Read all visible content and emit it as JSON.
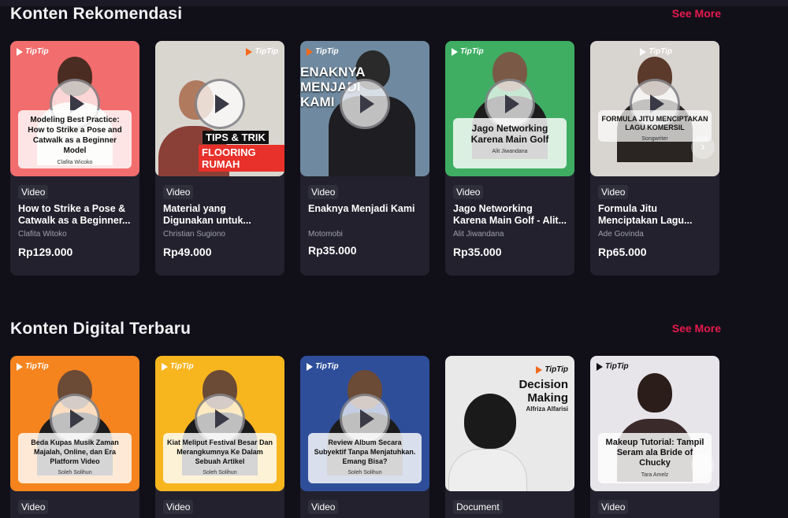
{
  "sections": [
    {
      "title": "Konten Rekomendasi",
      "see_more": "See More",
      "cards": [
        {
          "badge": "Video",
          "title": "How to Strike a Pose & Catwalk as a Beginner...",
          "creator": "Clafita Witoko",
          "price": "Rp129.000",
          "logo": "TipTip",
          "overlay_title": "Modeling Best Practice: How to Strike a Pose and Catwalk as a Beginner Model",
          "overlay_author": "Clafita Wicoko",
          "bg": "#f26d6d"
        },
        {
          "badge": "Video",
          "title": "Material yang Digunakan untuk...",
          "creator": "Christian Sugiono",
          "price": "Rp49.000",
          "logo": "TipTip",
          "thumb_tips": "TIPS & TRIK",
          "thumb_flooring": "FLOORING RUMAH",
          "bg": "#d9d6d0"
        },
        {
          "badge": "Video",
          "title": "Enaknya Menjadi Kami",
          "creator": "Motomobi",
          "price": "Rp35.000",
          "logo": "TipTip",
          "thumb_text": "ENAKNYA MENJADI KAMI",
          "bg": "#6f8aa0"
        },
        {
          "badge": "Video",
          "title": "Jago Networking Karena Main Golf - Alit...",
          "creator": "Alit Jiwandana",
          "price": "Rp35.000",
          "logo": "TipTip",
          "overlay_title": "Jago Networking Karena Main Golf",
          "overlay_author": "Alit Jiwandana",
          "bg": "#3fae62"
        },
        {
          "badge": "Video",
          "title": "Formula Jitu Menciptakan Lagu...",
          "creator": "Ade Govinda",
          "price": "Rp65.000",
          "logo": "TipTip",
          "overlay_title": "FORMULA JITU MENCIPTAKAN LAGU KOMERSIL",
          "overlay_author": "Songwriter",
          "bg": "#d8d4d0"
        }
      ]
    },
    {
      "title": "Konten Digital Terbaru",
      "see_more": "See More",
      "cards": [
        {
          "badge": "Video",
          "logo": "TipTip",
          "overlay_title": "Beda Kupas Musik Zaman Majalah, Online, dan Era Platform Video",
          "overlay_author": "Soleh Solihun",
          "bg": "#f5841f"
        },
        {
          "badge": "Video",
          "logo": "TipTip",
          "overlay_title": "Kiat Meliput Festival Besar Dan Merangkumnya Ke Dalam Sebuah Artikel",
          "overlay_author": "Soleh Solihun",
          "bg": "#f7b51e"
        },
        {
          "badge": "Video",
          "logo": "TipTip",
          "overlay_title": "Review Album Secara Subyektif Tanpa Menjatuhkan. Emang Bisa?",
          "overlay_author": "Soleh Solihun",
          "bg": "#2e4e9a"
        },
        {
          "badge": "Document",
          "logo": "TipTip",
          "doc_title": "Decision Making",
          "doc_author": "Alfriza Alfarisi",
          "bg": "#e9e9ea"
        },
        {
          "badge": "Video",
          "logo": "TipTip",
          "overlay_title": "Makeup Tutorial: Tampil Seram ala Bride of Chucky",
          "overlay_author": "Tara Amelz",
          "bg": "#e7e4ea"
        }
      ]
    }
  ],
  "colors": {
    "background": "#111019",
    "card": "#22212d",
    "accent": "#e8194e"
  }
}
